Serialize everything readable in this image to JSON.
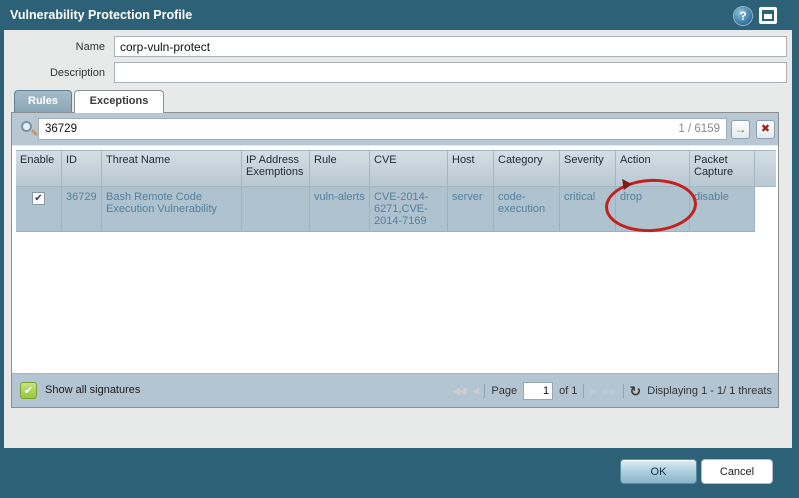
{
  "window": {
    "title": "Vulnerability Protection Profile"
  },
  "form": {
    "name_label": "Name",
    "name_value": "corp-vuln-protect",
    "description_label": "Description",
    "description_value": ""
  },
  "tabs": {
    "rules": "Rules",
    "exceptions": "Exceptions",
    "active": "Exceptions"
  },
  "search": {
    "value": "36729",
    "count": "1 / 6159"
  },
  "table": {
    "columns": [
      "Enable",
      "ID",
      "Threat Name",
      "IP Address Exemptions",
      "Rule",
      "CVE",
      "Host",
      "Category",
      "Severity",
      "Action",
      "Packet Capture"
    ],
    "rows": [
      {
        "enabled": true,
        "id": "36729",
        "threat_name": "Bash Remote Code Execution Vulnerability",
        "ip_address_exemptions": "",
        "rule": "vuln-alerts",
        "cve": "CVE-2014-6271,CVE-2014-7169",
        "host": "server",
        "category": "code-execution",
        "severity": "critical",
        "action": "drop",
        "packet_capture": "disable"
      }
    ]
  },
  "statusbar": {
    "show_all_label": "Show all signatures",
    "page_label": "Page",
    "page_value": "1",
    "of_label": "of 1",
    "displaying": "Displaying 1 - 1/ 1 threats"
  },
  "buttons": {
    "ok": "OK",
    "cancel": "Cancel"
  },
  "icons": {
    "help": "?",
    "go_arrow": "→",
    "clear_x": "✖",
    "first": "◀◀",
    "prev": "◀",
    "next": "▶",
    "last": "▶▶",
    "refresh": "↻",
    "check": "✔"
  },
  "annotation": {
    "shape": "ellipse",
    "highlights": "drop action cell",
    "color": "#c2221f"
  },
  "colors": {
    "titlebar_teal": "#2d6177",
    "body_gray": "#e8eaea",
    "toolbar_blue": "#b7c7d3",
    "row_blue": "#aec2cf",
    "link_text": "#54819c",
    "green_checkbox": "#94c83d",
    "annotation_red": "#c2221f"
  }
}
